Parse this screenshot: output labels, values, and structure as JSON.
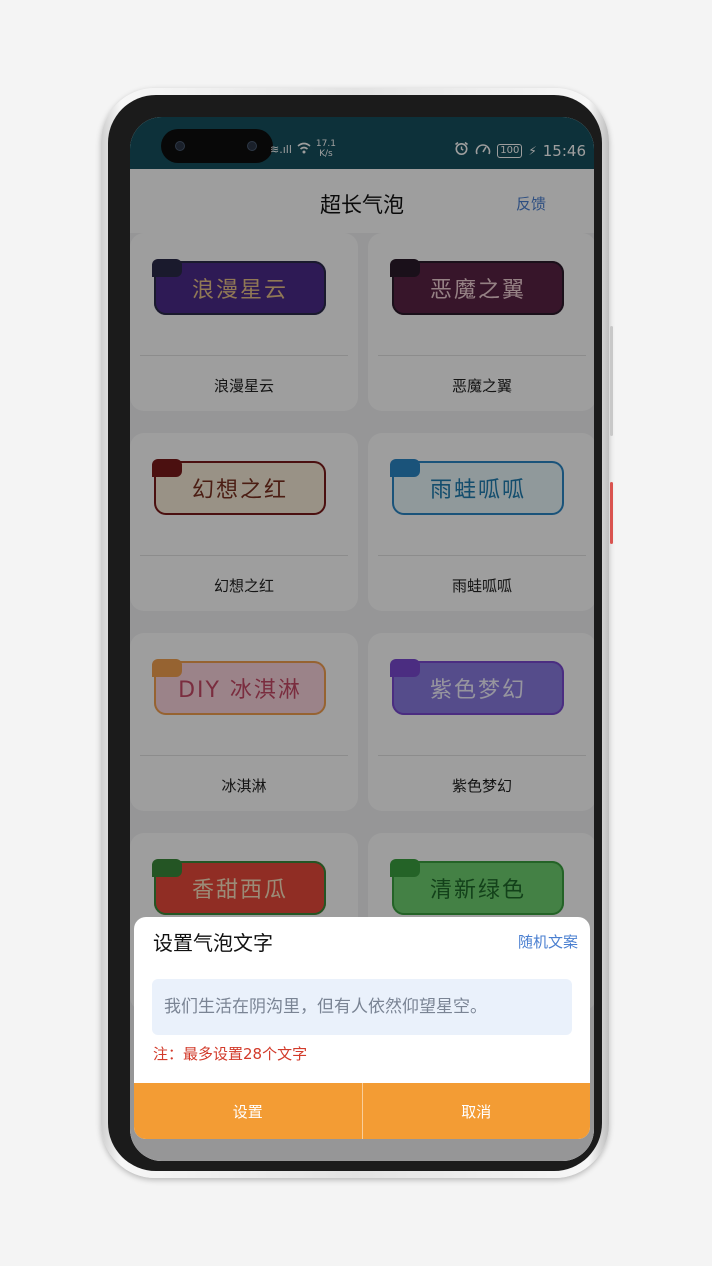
{
  "status_bar": {
    "signal": "≋.ıll",
    "wifi_icon": "wifi-icon",
    "net_speed_value": "17.1",
    "net_speed_unit": "K/s",
    "alarm_icon": "alarm-icon",
    "battery": "100",
    "time": "15:46"
  },
  "header": {
    "title": "超长气泡",
    "feedback": "反馈"
  },
  "bubbles": [
    {
      "text": "浪漫星云",
      "caption": "浪漫星云",
      "bg": "#4b2a8a",
      "fg": "#e8c28a",
      "tab": "#2a2a4a"
    },
    {
      "text": "恶魔之翼",
      "caption": "恶魔之翼",
      "bg": "#5a2345",
      "fg": "#f0d0d6",
      "tab": "#2b1a2a"
    },
    {
      "text": "幻想之红",
      "caption": "幻想之红",
      "bg": "#f7ecd8",
      "fg": "#7a3020",
      "tab": "#7a1a1a"
    },
    {
      "text": "雨蛙呱呱",
      "caption": "雨蛙呱呱",
      "bg": "#e9f7fb",
      "fg": "#1f7db0",
      "tab": "#2b86c6"
    },
    {
      "text": "DIY 冰淇淋",
      "caption": "冰淇淋",
      "bg": "#fbd4dd",
      "fg": "#c64a66",
      "tab": "#f2a050"
    },
    {
      "text": "紫色梦幻",
      "caption": "紫色梦幻",
      "bg": "#8a7be0",
      "fg": "#f2f0ff",
      "tab": "#7a4ad0"
    },
    {
      "text": "香甜西瓜",
      "caption": "",
      "bg": "#e94a3a",
      "fg": "#fbe0c0",
      "tab": "#3a8a3a"
    },
    {
      "text": "清新绿色",
      "caption": "",
      "bg": "#6fd070",
      "fg": "#1f6a2a",
      "tab": "#3aa040"
    }
  ],
  "dialog": {
    "title": "设置气泡文字",
    "random": "随机文案",
    "input_placeholder": "我们生活在阴沟里，但有人依然仰望星空。",
    "note": "注：最多设置28个文字",
    "confirm": "设置",
    "cancel": "取消"
  }
}
